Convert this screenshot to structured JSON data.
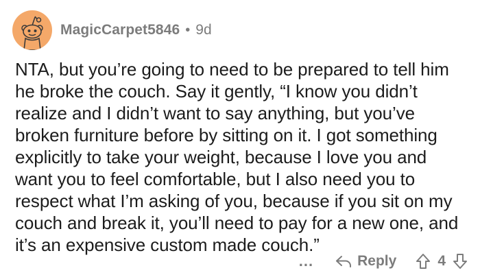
{
  "comment": {
    "author": "MagicCarpet5846",
    "separator": "•",
    "age": "9d",
    "body": "NTA, but you’re going to need to be prepared to tell him he broke the couch. Say it gently, “I know you didn’t realize and I didn’t want to say anything, but you’ve broken furniture before by sitting on it. I got something explicitly to take your weight, because I love you and want you to feel comfortable, but I also need you to respect what I’m asking of you, because if you sit on my couch and break it, you’ll need to pay for a new one, and it’s an expensive custom made couch.”"
  },
  "actions": {
    "more_label": "...",
    "reply_label": "Reply",
    "score": "4"
  },
  "colors": {
    "avatar_bg": "#f4a869",
    "meta_text": "#7c7c7c",
    "body_text": "#1c1c1c"
  },
  "icons": [
    "reddit-snoo-avatar-icon",
    "reply-arrow-icon",
    "upvote-arrow-icon",
    "downvote-arrow-icon"
  ]
}
